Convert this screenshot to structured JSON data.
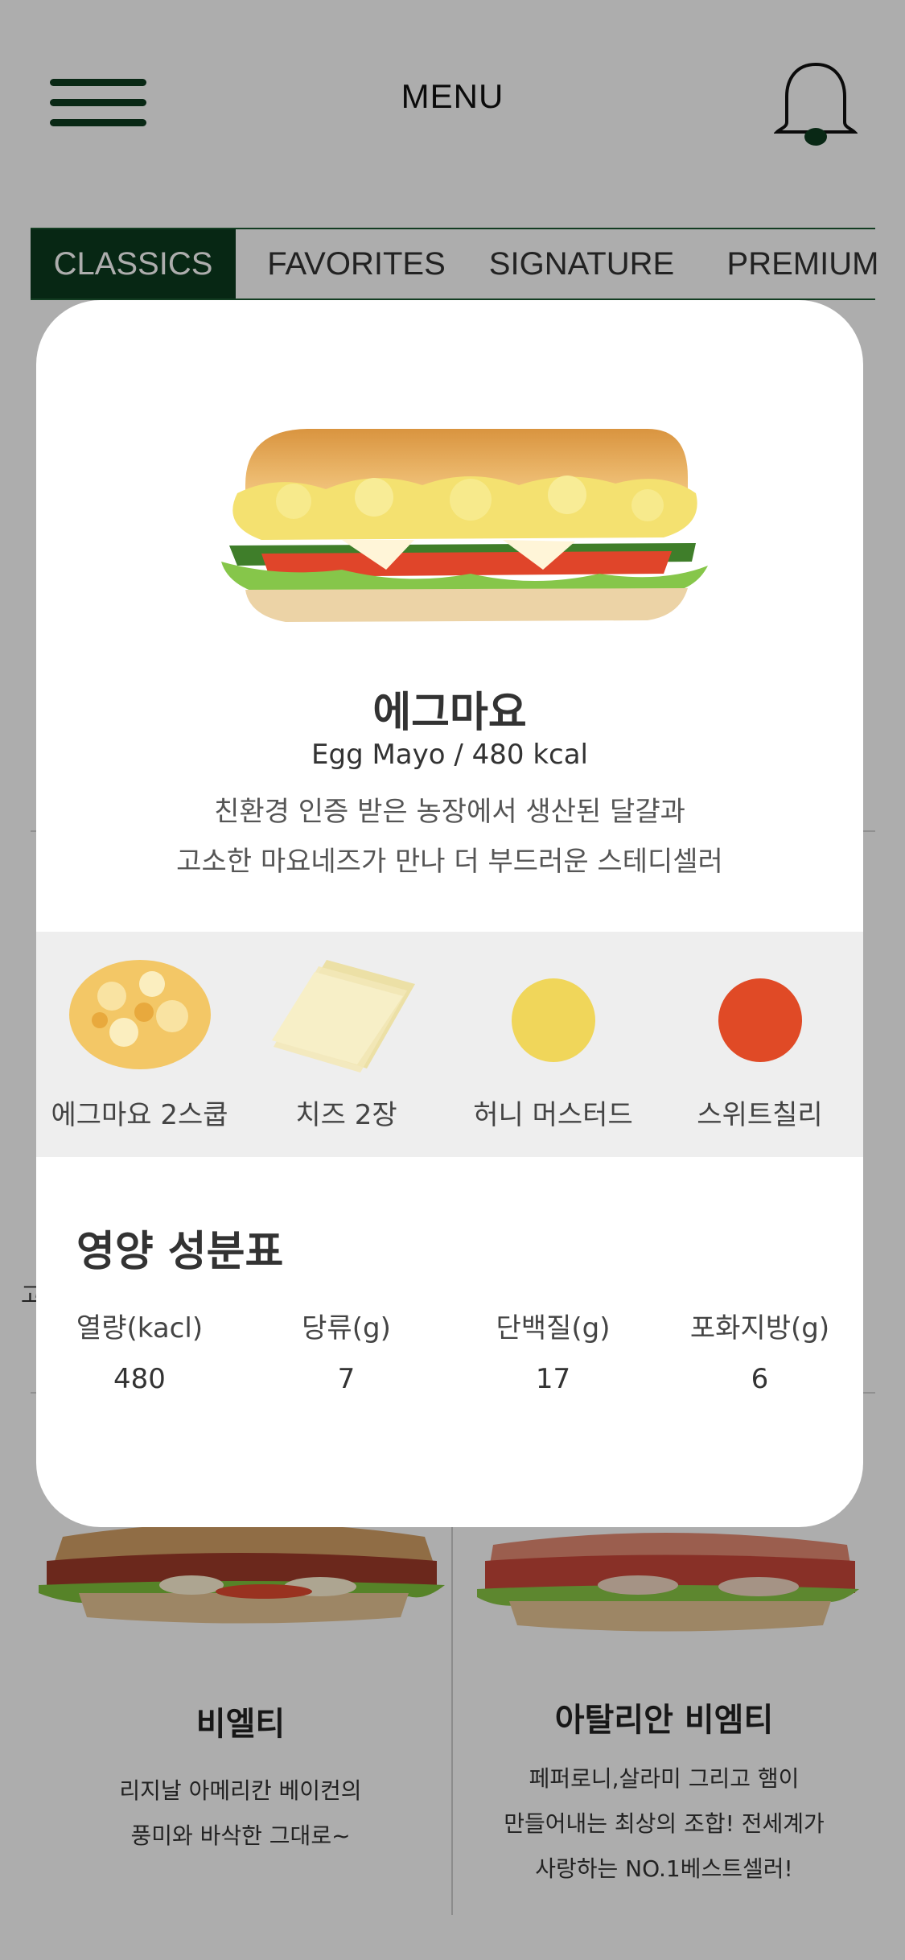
{
  "header": {
    "title": "MENU"
  },
  "tabs": [
    {
      "label": "CLASSICS",
      "active": true
    },
    {
      "label": "FAVORITES",
      "active": false
    },
    {
      "label": "SIGNATURE",
      "active": false
    },
    {
      "label": "PREMIUM",
      "active": false
    }
  ],
  "background": {
    "left_cut_1": "고",
    "cards": [
      {
        "name": "비엘티",
        "desc": [
          "리지날 아메리칸 베이컨의",
          "풍미와 바삭한 그대로~"
        ]
      },
      {
        "name": "아탈리안 비엠티",
        "desc": [
          "페퍼로니,살라미 그리고 햄이",
          "만들어내는 최상의 조합! 전세계가",
          "사랑하는 NO.1베스트셀러!"
        ]
      }
    ]
  },
  "modal": {
    "name": "에그마요",
    "subtitle": "Egg Mayo / 480 kcal",
    "desc_line1": "친환경 인증 받은 농장에서 생산된 달걀과",
    "desc_line2": "고소한 마요네즈가 만나 더 부드러운 스테디셀러",
    "ingredients": [
      {
        "label": "에그마요 2스쿱",
        "icon": "egg-mayo-scoop"
      },
      {
        "label": "치즈 2장",
        "icon": "cheese-slices"
      },
      {
        "label": "허니 머스터드",
        "icon": "sauce-dot",
        "color": "#f0d65a"
      },
      {
        "label": "스위트칠리",
        "icon": "sauce-dot",
        "color": "#e04a26"
      }
    ],
    "nutrition": {
      "title": "영양 성분표",
      "items": [
        {
          "label": "열량(kacl)",
          "value": "480"
        },
        {
          "label": "당류(g)",
          "value": "7"
        },
        {
          "label": "단백질(g)",
          "value": "17"
        },
        {
          "label": "포화지방(g)",
          "value": "6"
        }
      ]
    }
  },
  "colors": {
    "brand_dark_green": "#0b3a1e",
    "overlay": "rgba(0,0,0,0.32)"
  }
}
